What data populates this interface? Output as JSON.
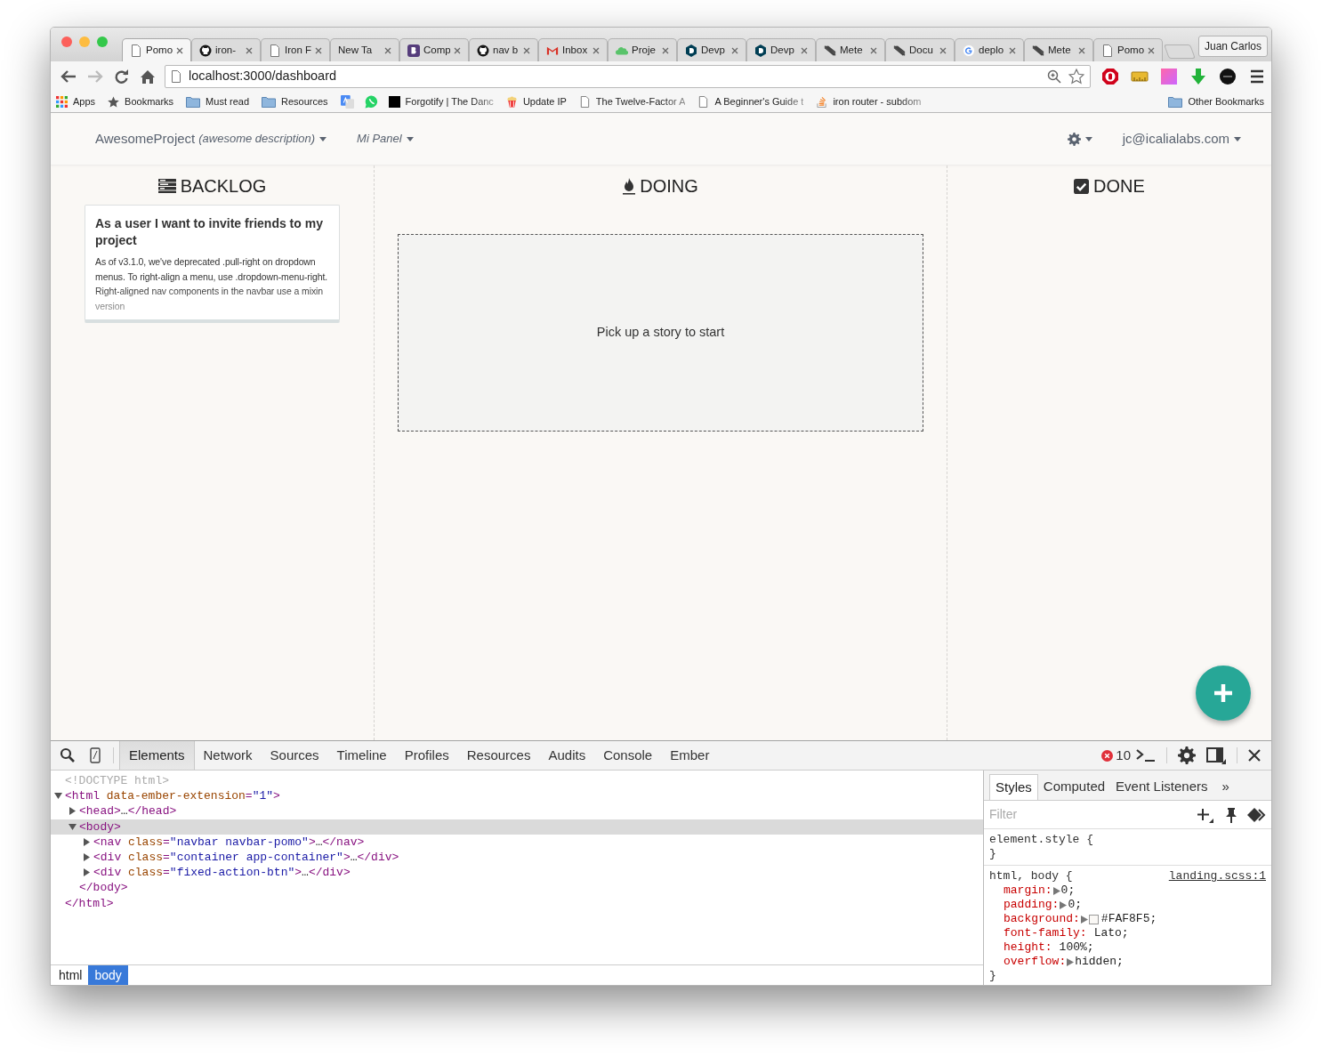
{
  "browser": {
    "tabs": [
      {
        "label": "Pomo",
        "kind": "page",
        "selected": true
      },
      {
        "label": "iron-",
        "kind": "github",
        "selected": false
      },
      {
        "label": "Iron F",
        "kind": "page",
        "selected": false
      },
      {
        "label": "New Ta",
        "kind": "none",
        "selected": false
      },
      {
        "label": "Comp",
        "kind": "bootstrap",
        "selected": false
      },
      {
        "label": "nav b",
        "kind": "github",
        "selected": false
      },
      {
        "label": "Inbox",
        "kind": "gmail",
        "selected": false
      },
      {
        "label": "Proje",
        "kind": "cloud",
        "selected": false
      },
      {
        "label": "Devp",
        "kind": "devpost",
        "selected": false
      },
      {
        "label": "Devp",
        "kind": "devpost",
        "selected": false
      },
      {
        "label": "Mete",
        "kind": "meteor",
        "selected": false
      },
      {
        "label": "Docu",
        "kind": "meteor",
        "selected": false
      },
      {
        "label": "deplo",
        "kind": "google",
        "selected": false
      },
      {
        "label": "Mete",
        "kind": "meteor",
        "selected": false
      },
      {
        "label": "Pomo",
        "kind": "page",
        "selected": false
      }
    ],
    "profile": "Juan Carlos",
    "url": "localhost:3000/dashboard",
    "bookmarks": [
      {
        "label": "Apps",
        "kind": "apps",
        "faded": false
      },
      {
        "label": "Bookmarks",
        "kind": "star",
        "faded": false
      },
      {
        "label": "Must read",
        "kind": "folder",
        "faded": false
      },
      {
        "label": "Resources",
        "kind": "folder",
        "faded": false
      },
      {
        "kind": "translate"
      },
      {
        "kind": "whatsapp"
      },
      {
        "label": "Forgotify | The Danc",
        "kind": "moon",
        "faded": true
      },
      {
        "label": "Update IP",
        "kind": "popcorn",
        "faded": false
      },
      {
        "label": "The Twelve-Factor A",
        "kind": "page",
        "faded": true
      },
      {
        "label": "A Beginner's Guide t",
        "kind": "page",
        "faded": true
      },
      {
        "label": "iron router - subdom",
        "kind": "stack",
        "faded": true
      }
    ],
    "other_bookmarks": "Other Bookmarks"
  },
  "app": {
    "navbar": {
      "project": "AwesomeProject",
      "description": "(awesome description)",
      "panel": "Mi Panel",
      "user": "jc@icalialabs.com"
    },
    "columns": [
      {
        "title": "BACKLOG",
        "kind": "backlog",
        "cards": [
          {
            "title": "As a user I want to invite friends to my project",
            "body": "As of v3.1.0, we've deprecated .pull-right on dropdown menus. To right-align a menu, use .dropdown-menu-right. Right-aligned nav components in the navbar use a mixin version"
          }
        ]
      },
      {
        "title": "DOING",
        "kind": "doing",
        "placeholder": "Pick up a story to start"
      },
      {
        "title": "DONE",
        "kind": "done"
      }
    ]
  },
  "devtools": {
    "tabs": [
      {
        "label": "Elements",
        "selected": true
      },
      {
        "label": "Network",
        "selected": false
      },
      {
        "label": "Sources",
        "selected": false
      },
      {
        "label": "Timeline",
        "selected": false
      },
      {
        "label": "Profiles",
        "selected": false
      },
      {
        "label": "Resources",
        "selected": false
      },
      {
        "label": "Audits",
        "selected": false
      },
      {
        "label": "Console",
        "selected": false
      },
      {
        "label": "Ember",
        "selected": false
      }
    ],
    "error_count": "10",
    "dom": [
      {
        "kind": "doctype",
        "tokens": [
          {
            "kind": "doctype",
            "text": "<!DOCTYPE html>"
          }
        ]
      },
      {
        "kind": "element",
        "expanded": true,
        "selected": false,
        "tokens": [
          {
            "kind": "tag",
            "text": "<html"
          },
          {
            "kind": "attr",
            "text": " data-ember-extension"
          },
          {
            "kind": "tag",
            "text": "="
          },
          {
            "kind": "value",
            "text": "\"1\""
          },
          {
            "kind": "tag",
            "text": ">"
          }
        ],
        "close": "</html>",
        "children": [
          {
            "kind": "element",
            "expanded": false,
            "selected": false,
            "tokens": [
              {
                "kind": "tag",
                "text": "<head>"
              },
              {
                "kind": "text",
                "text": "…"
              },
              {
                "kind": "tag",
                "text": "</head>"
              }
            ]
          },
          {
            "kind": "element",
            "expanded": true,
            "selected": true,
            "tokens": [
              {
                "kind": "tag",
                "text": "<body>"
              }
            ],
            "close": "</body>",
            "children": [
              {
                "kind": "element",
                "expanded": false,
                "selected": false,
                "tokens": [
                  {
                    "kind": "tag",
                    "text": "<nav"
                  },
                  {
                    "kind": "attr",
                    "text": " class"
                  },
                  {
                    "kind": "tag",
                    "text": "="
                  },
                  {
                    "kind": "value",
                    "text": "\"navbar navbar-pomo\""
                  },
                  {
                    "kind": "tag",
                    "text": ">"
                  },
                  {
                    "kind": "text",
                    "text": "…"
                  },
                  {
                    "kind": "tag",
                    "text": "</nav>"
                  }
                ]
              },
              {
                "kind": "element",
                "expanded": false,
                "selected": false,
                "tokens": [
                  {
                    "kind": "tag",
                    "text": "<div"
                  },
                  {
                    "kind": "attr",
                    "text": " class"
                  },
                  {
                    "kind": "tag",
                    "text": "="
                  },
                  {
                    "kind": "value",
                    "text": "\"container app-container\""
                  },
                  {
                    "kind": "tag",
                    "text": ">"
                  },
                  {
                    "kind": "text",
                    "text": "…"
                  },
                  {
                    "kind": "tag",
                    "text": "</div>"
                  }
                ]
              },
              {
                "kind": "element",
                "expanded": false,
                "selected": false,
                "tokens": [
                  {
                    "kind": "tag",
                    "text": "<div"
                  },
                  {
                    "kind": "attr",
                    "text": " class"
                  },
                  {
                    "kind": "tag",
                    "text": "="
                  },
                  {
                    "kind": "value",
                    "text": "\"fixed-action-btn\""
                  },
                  {
                    "kind": "tag",
                    "text": ">"
                  },
                  {
                    "kind": "text",
                    "text": "…"
                  },
                  {
                    "kind": "tag",
                    "text": "</div>"
                  }
                ]
              }
            ]
          }
        ]
      }
    ],
    "breadcrumbs": [
      {
        "label": "html",
        "selected": false
      },
      {
        "label": "body",
        "selected": true
      }
    ],
    "sidebar_tabs": [
      {
        "label": "Styles",
        "selected": true
      },
      {
        "label": "Computed",
        "selected": false
      },
      {
        "label": "Event Listeners",
        "selected": false
      }
    ],
    "more": "»",
    "filter": {
      "placeholder": "Filter"
    },
    "rules": [
      {
        "selector": "element.style {",
        "close": "}"
      },
      {
        "selector": "html, body {",
        "source": "landing.scss:1",
        "close": "}",
        "declarations": [
          {
            "property": "margin:",
            "value": "0;",
            "expandable": true
          },
          {
            "property": "padding:",
            "value": "0;",
            "expandable": true
          },
          {
            "property": "background:",
            "value": "#FAF8F5;",
            "expandable": true,
            "color": "#faf8f5"
          },
          {
            "property": "font-family:",
            "value": "Lato;",
            "expandable": false
          },
          {
            "property": "height:",
            "value": "100%;",
            "expandable": false
          },
          {
            "property": "overflow:",
            "value": "hidden;",
            "expandable": true
          }
        ]
      }
    ]
  }
}
